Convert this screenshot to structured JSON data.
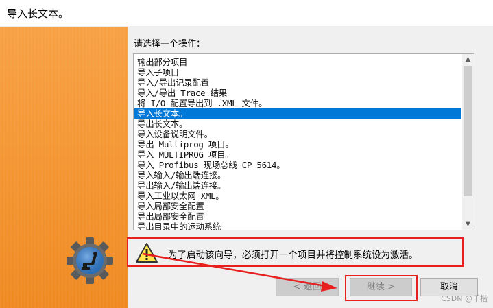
{
  "window": {
    "title": "导入长文本。"
  },
  "prompt_label": "请选择一个操作：",
  "operations": [
    "输出部分项目",
    "导入子项目",
    "导入/导出记录配置",
    "导入/导出 Trace 结果",
    "将 I/O 配置导出到 .XML 文件。",
    "导入长文本。",
    "导出长文本。",
    "导入设备说明文件。",
    "导出 Multiprog 项目。",
    "导入 MULTIPROG 项目。",
    "导入 Profibus 现场总线 CP 5614。",
    "导入输入/输出端连接。",
    "导出输入/输出端连接。",
    "导入工业以太网 XML。",
    "导入局部安全配置",
    "导出局部安全配置",
    "导出目录中的运动系统"
  ],
  "selected_operation": "导入长文本。",
  "scrollbar": {
    "up_glyph": "▲",
    "down_glyph": "▼"
  },
  "warning": {
    "icon": "warning-triangle-icon",
    "text": "为了启动该向导，必须打开一个项目并将控制系统设为激活。"
  },
  "buttons": {
    "back_label": "< 返回",
    "next_label": "继续 >",
    "cancel_label": "取消"
  },
  "watermark": "CSDN @千楷",
  "colors": {
    "selection": "#0078d7",
    "annotation_red": "#e81f1f",
    "side_panel_orange": "#f59836"
  }
}
